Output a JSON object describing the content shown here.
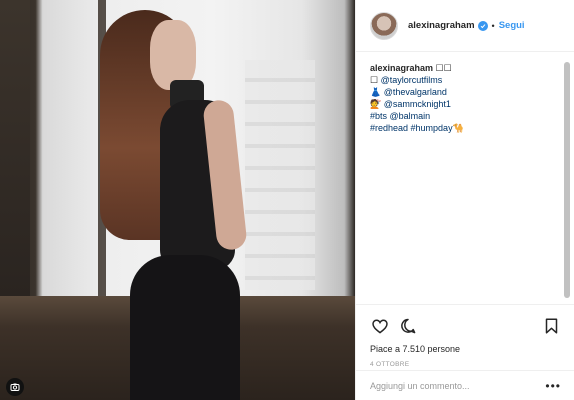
{
  "post": {
    "author": "alexinagraham",
    "follow_label": "Segui",
    "separator": "•",
    "caption_lines": [
      {
        "prefix": "alexinagraham",
        "text": " ☐☐"
      },
      {
        "prefix": "☐ ",
        "text": "@taylorcutfilms"
      },
      {
        "prefix": "👗 ",
        "text": "@thevalgarland"
      },
      {
        "prefix": "💇 ",
        "text": "@sammcknight1"
      },
      {
        "prefix": "",
        "text": "#bts @balmain"
      },
      {
        "prefix": "",
        "text": "#redhead #humpday🐪"
      }
    ],
    "likes_text": "Piace a 7.510 persone",
    "date_text": "4 OTTOBRE",
    "comment_placeholder": "Aggiungi un commento...",
    "more_label": "•••"
  },
  "icons": {
    "like": "heart-icon",
    "comment": "comment-icon",
    "save": "bookmark-icon",
    "verified": "verified-badge-icon",
    "media": "camera-icon"
  },
  "colors": {
    "accent": "#3897f0",
    "link": "#003569",
    "muted": "#999999"
  }
}
